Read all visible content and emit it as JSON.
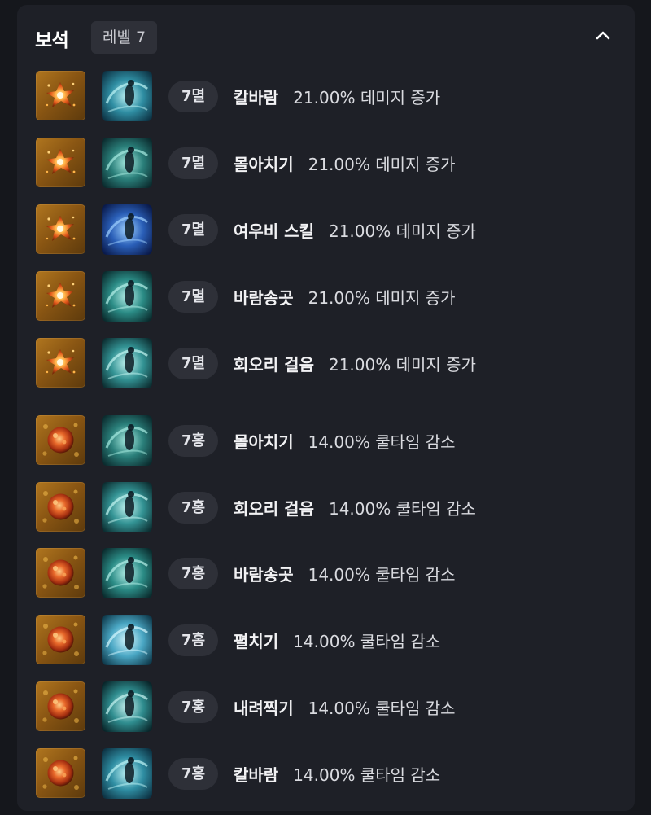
{
  "header": {
    "title": "보석",
    "level_label": "레벨 7"
  },
  "colors": {
    "background": "#15171c",
    "panel": "#1e2027",
    "badge": "#2e3038",
    "text_primary": "#f2f2f4",
    "text_secondary": "#dadbe0"
  },
  "gems": [
    {
      "type": "damage",
      "gem_icon": "damage-gem-icon",
      "skill_icon": "swirl-slash-skill-icon",
      "badge": "7멸",
      "skill": "칼바람",
      "effect": "21.00% 데미지 증가"
    },
    {
      "type": "damage",
      "gem_icon": "damage-gem-icon",
      "skill_icon": "vortex-skill-icon",
      "badge": "7멸",
      "skill": "몰아치기",
      "effect": "21.00% 데미지 증가"
    },
    {
      "type": "damage",
      "gem_icon": "damage-gem-icon",
      "skill_icon": "rain-umbrella-skill-icon",
      "badge": "7멸",
      "skill": "여우비 스킬",
      "effect": "21.00% 데미지 증가"
    },
    {
      "type": "damage",
      "gem_icon": "damage-gem-icon",
      "skill_icon": "umbrella-spin-skill-icon",
      "badge": "7멸",
      "skill": "바람송곳",
      "effect": "21.00% 데미지 증가"
    },
    {
      "type": "damage",
      "gem_icon": "damage-gem-icon",
      "skill_icon": "circle-dance-skill-icon",
      "badge": "7멸",
      "skill": "회오리 걸음",
      "effect": "21.00% 데미지 증가"
    },
    {
      "type": "cooldown",
      "gem_icon": "cooldown-gem-icon",
      "skill_icon": "vortex-skill-icon",
      "badge": "7홍",
      "skill": "몰아치기",
      "effect": "14.00% 쿨타임 감소"
    },
    {
      "type": "cooldown",
      "gem_icon": "cooldown-gem-icon",
      "skill_icon": "circle-dance-skill-icon",
      "badge": "7홍",
      "skill": "회오리 걸음",
      "effect": "14.00% 쿨타임 감소"
    },
    {
      "type": "cooldown",
      "gem_icon": "cooldown-gem-icon",
      "skill_icon": "umbrella-spin-skill-icon",
      "badge": "7홍",
      "skill": "바람송곳",
      "effect": "14.00% 쿨타임 감소"
    },
    {
      "type": "cooldown",
      "gem_icon": "cooldown-gem-icon",
      "skill_icon": "umbrella-burst-skill-icon",
      "badge": "7홍",
      "skill": "펼치기",
      "effect": "14.00% 쿨타임 감소"
    },
    {
      "type": "cooldown",
      "gem_icon": "cooldown-gem-icon",
      "skill_icon": "downward-strike-skill-icon",
      "badge": "7홍",
      "skill": "내려찍기",
      "effect": "14.00% 쿨타임 감소"
    },
    {
      "type": "cooldown",
      "gem_icon": "cooldown-gem-icon",
      "skill_icon": "swirl-slash-skill-icon",
      "badge": "7홍",
      "skill": "칼바람",
      "effect": "14.00% 쿨타임 감소"
    }
  ]
}
